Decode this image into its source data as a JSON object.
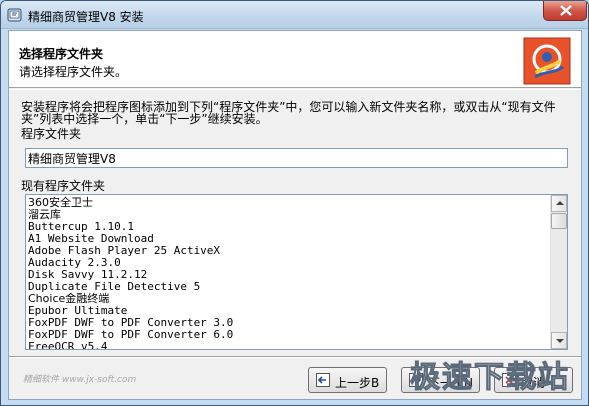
{
  "window": {
    "title": "精细商贸管理V8 安装"
  },
  "header": {
    "title": "选择程序文件夹",
    "subtitle": "请选择程序文件夹。"
  },
  "body": {
    "description": "安装程序将会把程序图标添加到下列“程序文件夹”中，您可以输入新文件夹名称，或双击从“现有文件夹”列表中选择一个，单击“下一步”继续安装。",
    "folder_label": "程序文件夹",
    "folder_value": "精细商贸管理V8",
    "existing_label": "现有程序文件夹",
    "existing_folders": [
      "360安全卫士",
      "溜云库",
      "Buttercup 1.10.1",
      "A1 Website Download",
      "Adobe Flash Player 25 ActiveX",
      "Audacity 2.3.0",
      "Disk Savvy 11.2.12",
      "Duplicate File Detective 5",
      "Choice金融终端",
      "Epubor Ultimate",
      "FoxPDF DWF to PDF Converter 3.0",
      "FoxPDF DWF to PDF Converter 6.0",
      "FreeOCR v5.4"
    ]
  },
  "footer": {
    "brand_text": "精细软件 www.jx-soft.com",
    "back_label": "上一步B",
    "next_label": "下一步N",
    "cancel_label": "取消",
    "watermark": "极速下载站"
  }
}
